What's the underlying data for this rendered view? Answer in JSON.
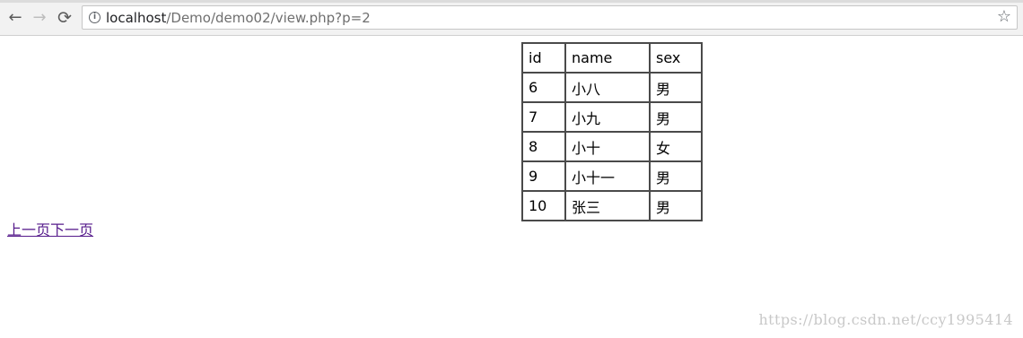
{
  "browser": {
    "url_host": "localhost",
    "url_path": "/Demo/demo02/view.php?p=2",
    "back_glyph": "←",
    "forward_glyph": "→",
    "reload_glyph": "⟳",
    "info_glyph": "i",
    "star_glyph": "☆"
  },
  "table": {
    "headers": [
      "id",
      "name",
      "sex"
    ],
    "rows": [
      [
        "6",
        "小八",
        "男"
      ],
      [
        "7",
        "小九",
        "男"
      ],
      [
        "8",
        "小十",
        "女"
      ],
      [
        "9",
        "小十一",
        "男"
      ],
      [
        "10",
        "张三",
        "男"
      ]
    ]
  },
  "pager": {
    "prev_label": "上一页",
    "next_label": "下一页"
  },
  "watermark": {
    "text": "https://blog.csdn.net/ccy1995414"
  }
}
